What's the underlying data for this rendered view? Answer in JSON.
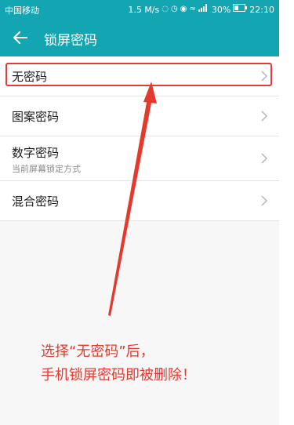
{
  "status_bar": {
    "carrier": "中国移动",
    "speed": "1.5 M/s",
    "battery": "30%",
    "time": "22:10"
  },
  "app_bar": {
    "title": "锁屏密码",
    "back_icon": "arrow-left-icon"
  },
  "options": [
    {
      "label": "无密码",
      "sub": ""
    },
    {
      "label": "图案密码",
      "sub": ""
    },
    {
      "label": "数字密码",
      "sub": "当前屏幕锁定方式"
    },
    {
      "label": "混合密码",
      "sub": ""
    }
  ],
  "annotation": {
    "line1": "选择“无密码”后，",
    "line2": "手机锁屏密码即被删除！"
  },
  "colors": {
    "accent": "#14a5b2",
    "annotation_red": "#e43a2e"
  }
}
